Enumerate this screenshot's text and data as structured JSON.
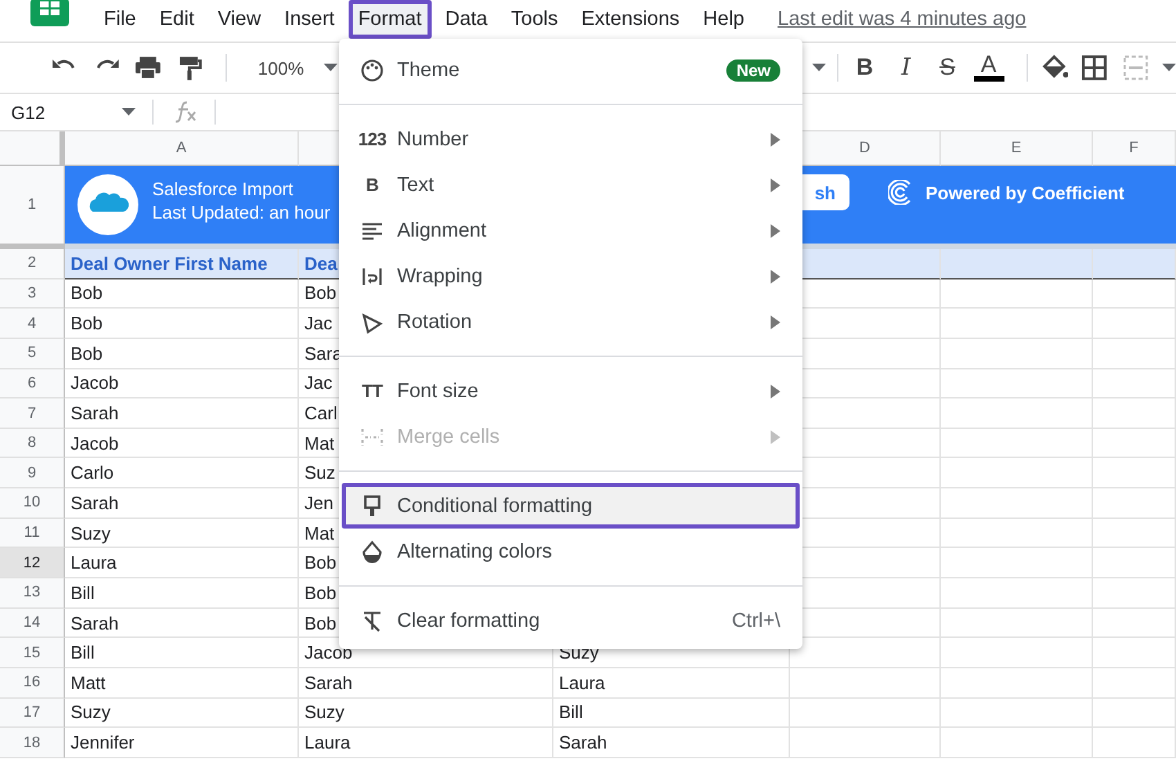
{
  "menubar": {
    "menus": [
      {
        "label": "File",
        "selected": false
      },
      {
        "label": "Edit",
        "selected": false
      },
      {
        "label": "View",
        "selected": false
      },
      {
        "label": "Insert",
        "selected": false
      },
      {
        "label": "Format",
        "selected": true
      },
      {
        "label": "Data",
        "selected": false
      },
      {
        "label": "Tools",
        "selected": false
      },
      {
        "label": "Extensions",
        "selected": false
      },
      {
        "label": "Help",
        "selected": false
      }
    ],
    "last_edit": "Last edit was 4 minutes ago"
  },
  "toolbar": {
    "zoom": "100%",
    "format_buttons": [
      {
        "kind": "bold",
        "label": "B"
      },
      {
        "kind": "italic",
        "label": "I"
      },
      {
        "kind": "strike",
        "label": "S"
      },
      {
        "kind": "color",
        "label": "A"
      }
    ]
  },
  "formula_bar": {
    "cell_ref": "G12"
  },
  "sheet": {
    "column_headers": [
      "A",
      "D",
      "E",
      "F"
    ],
    "banner": {
      "row_number": "1",
      "title": "Salesforce Import",
      "subtitle": "Last Updated: an hour",
      "button": "sh",
      "powered_by": "Powered by Coefficient"
    },
    "rows": [
      {
        "number": "2",
        "selected": false,
        "kind": "header",
        "cells": [
          "Deal Owner First Name",
          "Dea"
        ]
      },
      {
        "number": "3",
        "selected": false,
        "kind": "data",
        "cells": [
          "Bob",
          "Bob"
        ]
      },
      {
        "number": "4",
        "selected": false,
        "kind": "data",
        "cells": [
          "Bob",
          "Jac"
        ]
      },
      {
        "number": "5",
        "selected": false,
        "kind": "data",
        "cells": [
          "Bob",
          "Sara"
        ]
      },
      {
        "number": "6",
        "selected": false,
        "kind": "data",
        "cells": [
          "Jacob",
          "Jac"
        ]
      },
      {
        "number": "7",
        "selected": false,
        "kind": "data",
        "cells": [
          "Sarah",
          "Carl"
        ]
      },
      {
        "number": "8",
        "selected": false,
        "kind": "data",
        "cells": [
          "Jacob",
          "Mat"
        ]
      },
      {
        "number": "9",
        "selected": false,
        "kind": "data",
        "cells": [
          "Carlo",
          "Suz"
        ]
      },
      {
        "number": "10",
        "selected": false,
        "kind": "data",
        "cells": [
          "Sarah",
          "Jen"
        ]
      },
      {
        "number": "11",
        "selected": false,
        "kind": "data",
        "cells": [
          "Suzy",
          "Mat"
        ]
      },
      {
        "number": "12",
        "selected": true,
        "kind": "data",
        "cells": [
          "Laura",
          "Bob"
        ]
      },
      {
        "number": "13",
        "selected": false,
        "kind": "data",
        "cells": [
          "Bill",
          "Bob"
        ]
      },
      {
        "number": "14",
        "selected": false,
        "kind": "data",
        "cells": [
          "Sarah",
          "Bob"
        ]
      },
      {
        "number": "15",
        "selected": false,
        "kind": "data",
        "cells": [
          "Bill",
          "Jacob",
          "Suzy"
        ]
      },
      {
        "number": "16",
        "selected": false,
        "kind": "data",
        "cells": [
          "Matt",
          "Sarah",
          "Laura"
        ]
      },
      {
        "number": "17",
        "selected": false,
        "kind": "data",
        "cells": [
          "Suzy",
          "Suzy",
          "Bill"
        ]
      },
      {
        "number": "18",
        "selected": false,
        "kind": "data",
        "cells": [
          "Jennifer",
          "Laura",
          "Sarah"
        ]
      }
    ]
  },
  "format_menu": {
    "sections": [
      [
        {
          "label": "Theme",
          "badge": "New",
          "submenu": false,
          "disabled": false,
          "highlighted": false
        }
      ],
      [
        {
          "label": "Number",
          "icon_text": "123",
          "submenu": true,
          "disabled": false,
          "highlighted": false
        },
        {
          "label": "Text",
          "icon_text": "B",
          "submenu": true,
          "disabled": false,
          "highlighted": false
        },
        {
          "label": "Alignment",
          "submenu": true,
          "disabled": false,
          "highlighted": false
        },
        {
          "label": "Wrapping",
          "submenu": true,
          "disabled": false,
          "highlighted": false
        },
        {
          "label": "Rotation",
          "submenu": true,
          "disabled": false,
          "highlighted": false
        }
      ],
      [
        {
          "label": "Font size",
          "icon_text": "TT",
          "submenu": true,
          "disabled": false,
          "highlighted": false
        },
        {
          "label": "Merge cells",
          "submenu": true,
          "disabled": true,
          "highlighted": false
        }
      ],
      [
        {
          "label": "Conditional formatting",
          "submenu": false,
          "disabled": false,
          "highlighted": true
        },
        {
          "label": "Alternating colors",
          "submenu": false,
          "disabled": false,
          "highlighted": false
        }
      ],
      [
        {
          "label": "Clear formatting",
          "shortcut": "Ctrl+\\",
          "submenu": false,
          "disabled": false,
          "highlighted": false
        }
      ]
    ]
  }
}
